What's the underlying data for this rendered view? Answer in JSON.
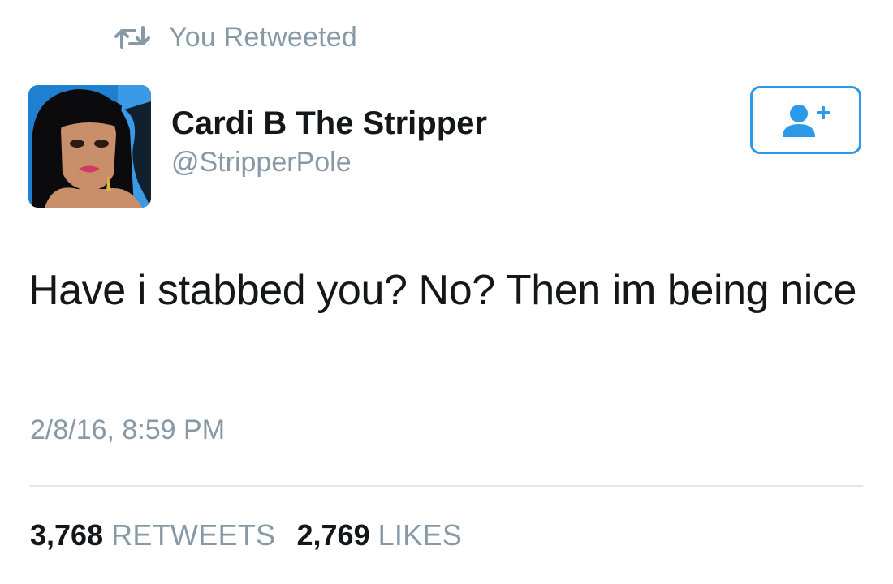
{
  "retweet_context": {
    "icon": "retweet-icon",
    "text": "You Retweeted"
  },
  "author": {
    "avatar": "avatar",
    "display_name": "Cardi B The Stripper",
    "handle": "@StripperPole"
  },
  "follow_button": {
    "icon": "add-user-icon"
  },
  "tweet": {
    "text": "Have i stabbed you? No? Then im being nice",
    "timestamp": "2/8/16, 8:59 PM"
  },
  "stats": {
    "retweets_count": "3,768",
    "retweets_label": "RETWEETS",
    "likes_count": "2,769",
    "likes_label": "LIKES"
  },
  "colors": {
    "accent": "#2b9ae8",
    "muted": "#8899a6",
    "text": "#14171a",
    "divider": "#e1e8ed"
  }
}
